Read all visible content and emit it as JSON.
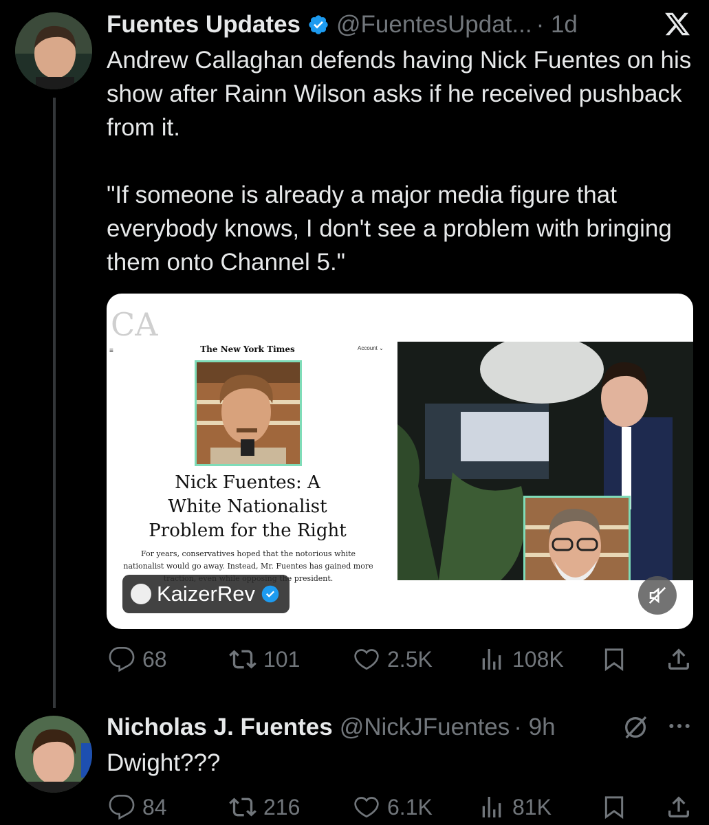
{
  "post1": {
    "display_name": "Fuentes Updates",
    "handle": "@FuentesUpdat...",
    "time": "· 1d",
    "text": "Andrew Callaghan defends having Nick Fuentes on his show after Rainn Wilson asks if he received pushback from it.\n\n\"If someone is already a major media figure that everybody knows, I don't see a problem with bringing them onto Channel 5.\"",
    "media": {
      "watermark": "CA",
      "nyt_masthead": "The New York Times",
      "nyt_account": "Account ⌄",
      "headline": "Nick Fuentes: A White Nationalist Problem for the Right",
      "dek": "For years, conservatives hoped that the notorious white nationalist would go away. Instead, Mr. Fuentes has gained more traction, even while opposing the president.",
      "creator_tag": "KaizerRev"
    },
    "counts": {
      "replies": "68",
      "reposts": "101",
      "likes": "2.5K",
      "views": "108K"
    }
  },
  "post2": {
    "display_name": "Nicholas J. Fuentes",
    "handle": "@NickJFuentes",
    "time": "· 9h",
    "text": "Dwight???",
    "counts": {
      "replies": "84",
      "reposts": "216",
      "likes": "6.1K",
      "views": "81K"
    }
  },
  "colors": {
    "verified": "#1d9bf0",
    "muted_text": "#71767b",
    "primary_text": "#e7e9ea",
    "background": "#000000",
    "nyt_frame": "#7fdcb8"
  },
  "icons": [
    "verified-badge-icon",
    "x-logo-icon",
    "reply-icon",
    "repost-icon",
    "like-icon",
    "views-icon",
    "bookmark-icon",
    "share-icon",
    "mute-icon",
    "grok-icon",
    "more-icon"
  ]
}
